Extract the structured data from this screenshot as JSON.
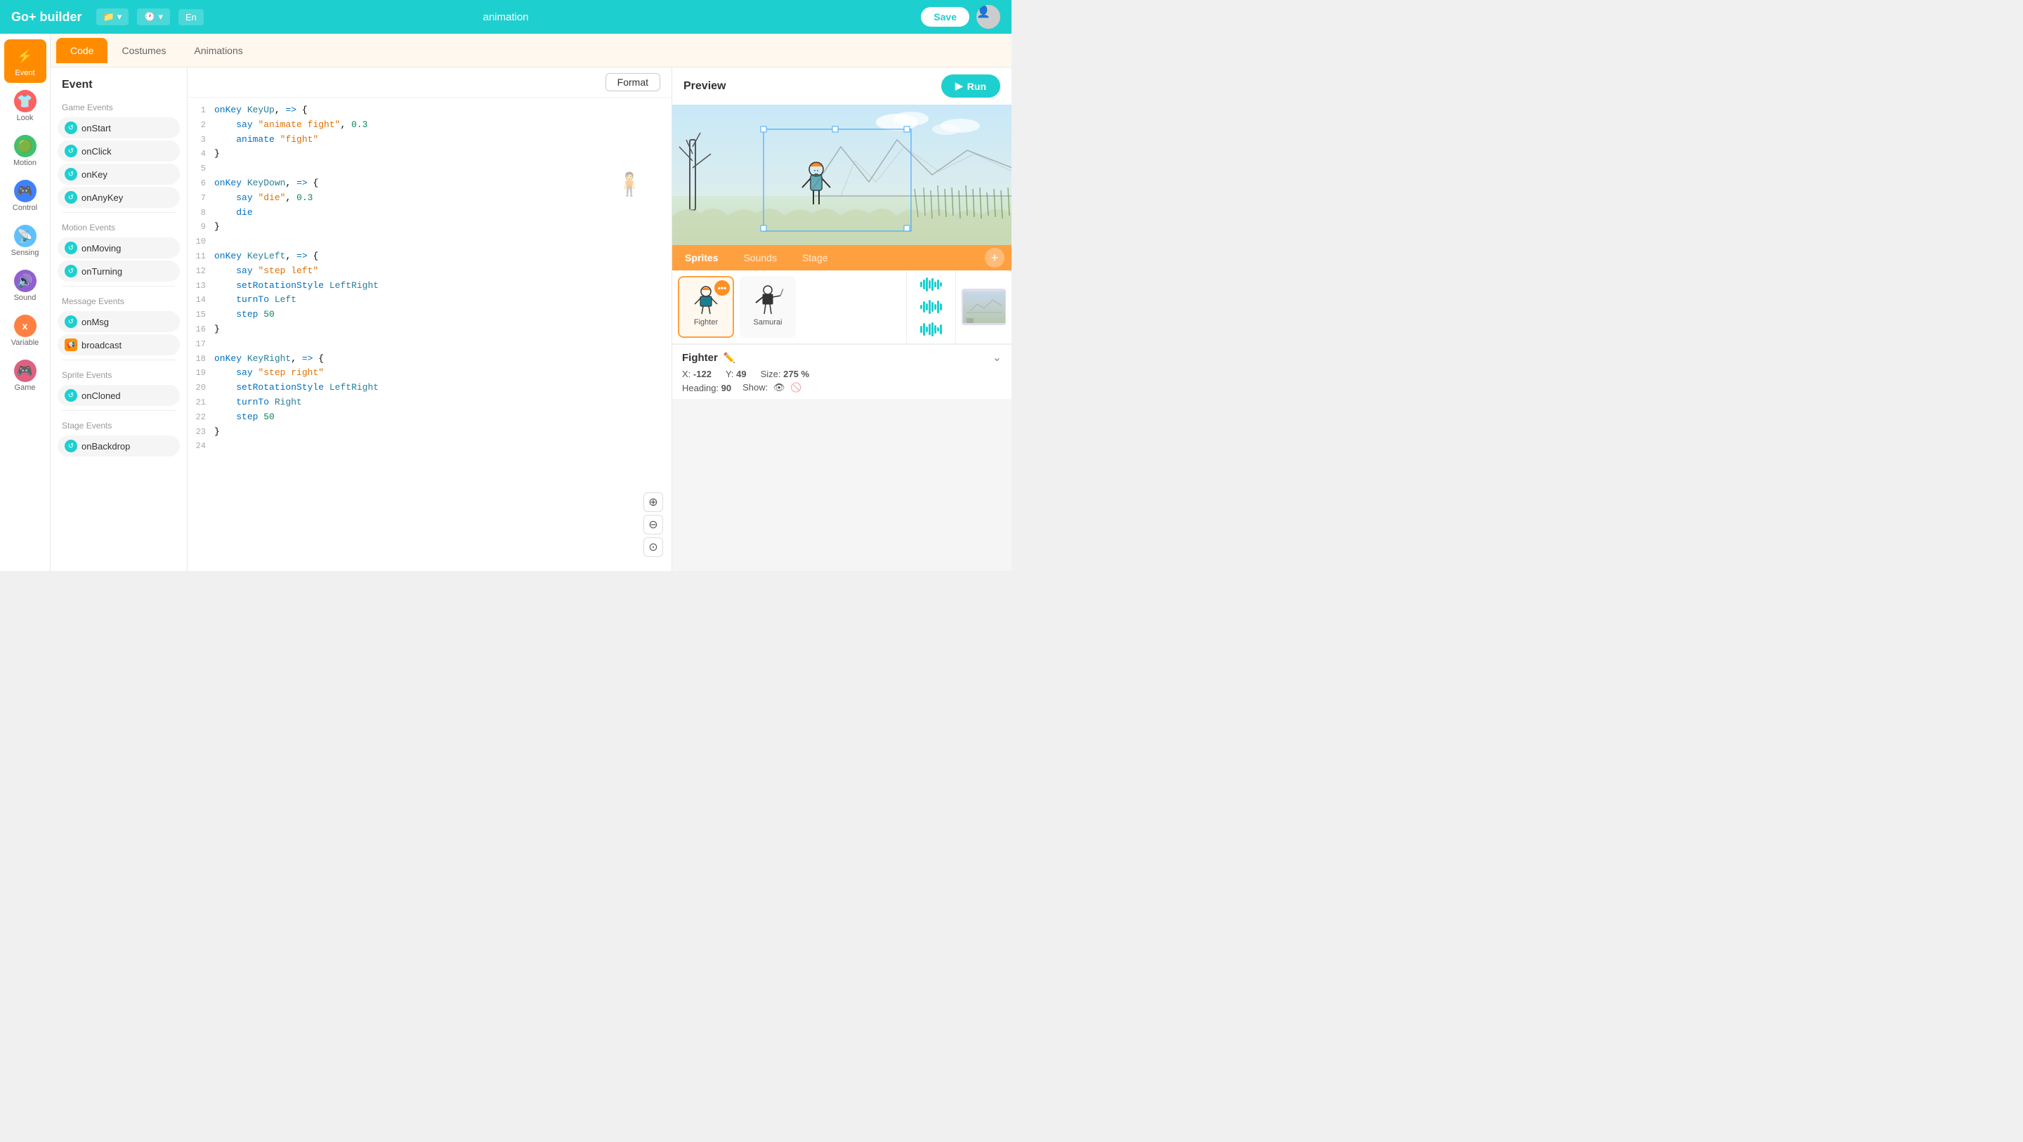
{
  "app": {
    "title": "Go+ builder",
    "project_name": "animation"
  },
  "topbar": {
    "save_label": "Save",
    "file_icon": "📁",
    "history_icon": "🕐",
    "lang": "En"
  },
  "tabs": {
    "items": [
      {
        "id": "code",
        "label": "Code",
        "active": true
      },
      {
        "id": "costumes",
        "label": "Costumes",
        "active": false
      },
      {
        "id": "animations",
        "label": "Animations",
        "active": false
      }
    ]
  },
  "sidebar_icons": [
    {
      "id": "event",
      "label": "Event",
      "active": true,
      "icon": "⚡"
    },
    {
      "id": "look",
      "label": "Look",
      "active": false,
      "icon": "👕"
    },
    {
      "id": "motion",
      "label": "Motion",
      "active": false,
      "icon": "🟢"
    },
    {
      "id": "control",
      "label": "Control",
      "active": false,
      "icon": "🎮"
    },
    {
      "id": "sensing",
      "label": "Sensing",
      "active": false,
      "icon": "📡"
    },
    {
      "id": "sound",
      "label": "Sound",
      "active": false,
      "icon": "🔊"
    },
    {
      "id": "variable",
      "label": "Variable",
      "active": false,
      "icon": "x"
    },
    {
      "id": "game",
      "label": "Game",
      "active": false,
      "icon": "🎮"
    }
  ],
  "events_panel": {
    "title": "Event",
    "sections": [
      {
        "label": "Game Events",
        "buttons": [
          {
            "id": "onStart",
            "label": "onStart"
          },
          {
            "id": "onClick",
            "label": "onClick"
          },
          {
            "id": "onKey",
            "label": "onKey"
          },
          {
            "id": "onAnyKey",
            "label": "onAnyKey"
          }
        ]
      },
      {
        "label": "Motion Events",
        "buttons": [
          {
            "id": "onMoving",
            "label": "onMoving"
          },
          {
            "id": "onTurning",
            "label": "onTurning"
          }
        ]
      },
      {
        "label": "Message Events",
        "buttons": [
          {
            "id": "onMsg",
            "label": "onMsg"
          },
          {
            "id": "broadcast",
            "label": "broadcast",
            "special": true
          }
        ]
      },
      {
        "label": "Sprite Events",
        "buttons": [
          {
            "id": "onCloned",
            "label": "onCloned"
          }
        ]
      },
      {
        "label": "Stage Events",
        "buttons": [
          {
            "id": "onBackdrop",
            "label": "onBackdrop"
          }
        ]
      }
    ]
  },
  "code_toolbar": {
    "format_label": "Format"
  },
  "code_lines": [
    {
      "num": 1,
      "content": "onKey KeyUp, => {",
      "type": "mixed"
    },
    {
      "num": 2,
      "content": "    say \"animate fight\", 0.3",
      "type": "mixed"
    },
    {
      "num": 3,
      "content": "    animate \"fight\"",
      "type": "mixed"
    },
    {
      "num": 4,
      "content": "}",
      "type": "plain"
    },
    {
      "num": 5,
      "content": "",
      "type": "empty"
    },
    {
      "num": 6,
      "content": "onKey KeyDown, => {",
      "type": "mixed"
    },
    {
      "num": 7,
      "content": "    say \"die\", 0.3",
      "type": "mixed"
    },
    {
      "num": 8,
      "content": "    die",
      "type": "plain"
    },
    {
      "num": 9,
      "content": "}",
      "type": "plain"
    },
    {
      "num": 10,
      "content": "",
      "type": "empty"
    },
    {
      "num": 11,
      "content": "onKey KeyLeft, => {",
      "type": "mixed"
    },
    {
      "num": 12,
      "content": "    say \"step left\"",
      "type": "mixed"
    },
    {
      "num": 13,
      "content": "    setRotationStyle LeftRight",
      "type": "mixed"
    },
    {
      "num": 14,
      "content": "    turnTo Left",
      "type": "mixed"
    },
    {
      "num": 15,
      "content": "    step 50",
      "type": "mixed"
    },
    {
      "num": 16,
      "content": "}",
      "type": "plain"
    },
    {
      "num": 17,
      "content": "",
      "type": "empty"
    },
    {
      "num": 18,
      "content": "onKey KeyRight, => {",
      "type": "mixed"
    },
    {
      "num": 19,
      "content": "    say \"step right\"",
      "type": "mixed"
    },
    {
      "num": 20,
      "content": "    setRotationStyle LeftRight",
      "type": "mixed"
    },
    {
      "num": 21,
      "content": "    turnTo Right",
      "type": "mixed"
    },
    {
      "num": 22,
      "content": "    step 50",
      "type": "mixed"
    },
    {
      "num": 23,
      "content": "}",
      "type": "plain"
    },
    {
      "num": 24,
      "content": "",
      "type": "empty"
    }
  ],
  "preview": {
    "title": "Preview",
    "run_label": "▶ Run"
  },
  "sprites_panel": {
    "tab_sprites": "Sprites",
    "tab_sounds": "Sounds",
    "tab_stage": "Stage",
    "sprites": [
      {
        "id": "fighter",
        "name": "Fighter",
        "selected": true,
        "emoji": "🥷"
      },
      {
        "id": "samurai",
        "name": "Samurai",
        "selected": false,
        "emoji": "🗡️"
      }
    ]
  },
  "sprite_info": {
    "name": "Fighter",
    "x_label": "X:",
    "x_value": "-122",
    "y_label": "Y:",
    "y_value": "49",
    "size_label": "Size:",
    "size_value": "275 %",
    "heading_label": "Heading:",
    "heading_value": "90",
    "show_label": "Show:"
  }
}
